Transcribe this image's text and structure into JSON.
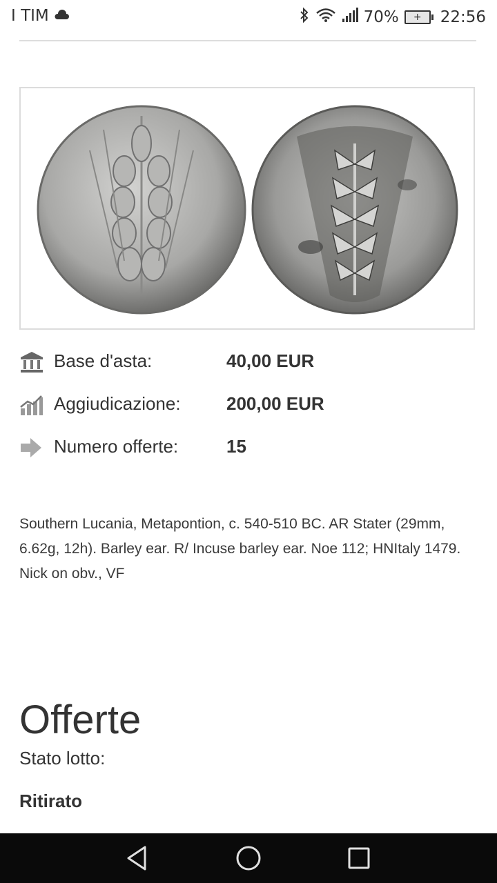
{
  "status_bar": {
    "carrier": "I TIM",
    "battery_percent": "70%",
    "time": "22:56",
    "icons": [
      "cloud-icon",
      "bluetooth-icon",
      "wifi-icon",
      "signal-icon",
      "battery-icon"
    ]
  },
  "lot": {
    "image_alt": "coin-obverse-reverse",
    "info": [
      {
        "icon": "bank-icon",
        "label": "Base d'asta:",
        "value": "40,00 EUR"
      },
      {
        "icon": "chart-icon",
        "label": "Aggiudicazione:",
        "value": "200,00 EUR"
      },
      {
        "icon": "arrow-right-icon",
        "label": "Numero offerte:",
        "value": "15"
      }
    ],
    "description": "Southern Lucania, Metapontion, c. 540-510 BC. AR Stater (29mm, 6.62g, 12h). Barley ear. R/ Incuse barley ear. Noe 112; HNItaly 1479. Nick on obv., VF"
  },
  "offers": {
    "title": "Offerte",
    "status_label": "Stato lotto:",
    "status_value": "Ritirato"
  },
  "nav_bar": {
    "buttons": [
      "back-icon",
      "home-icon",
      "recents-icon"
    ]
  },
  "colors": {
    "text": "#333333",
    "nav_background": "#0a0a0a",
    "coin_silver": "#a8a8a8"
  }
}
